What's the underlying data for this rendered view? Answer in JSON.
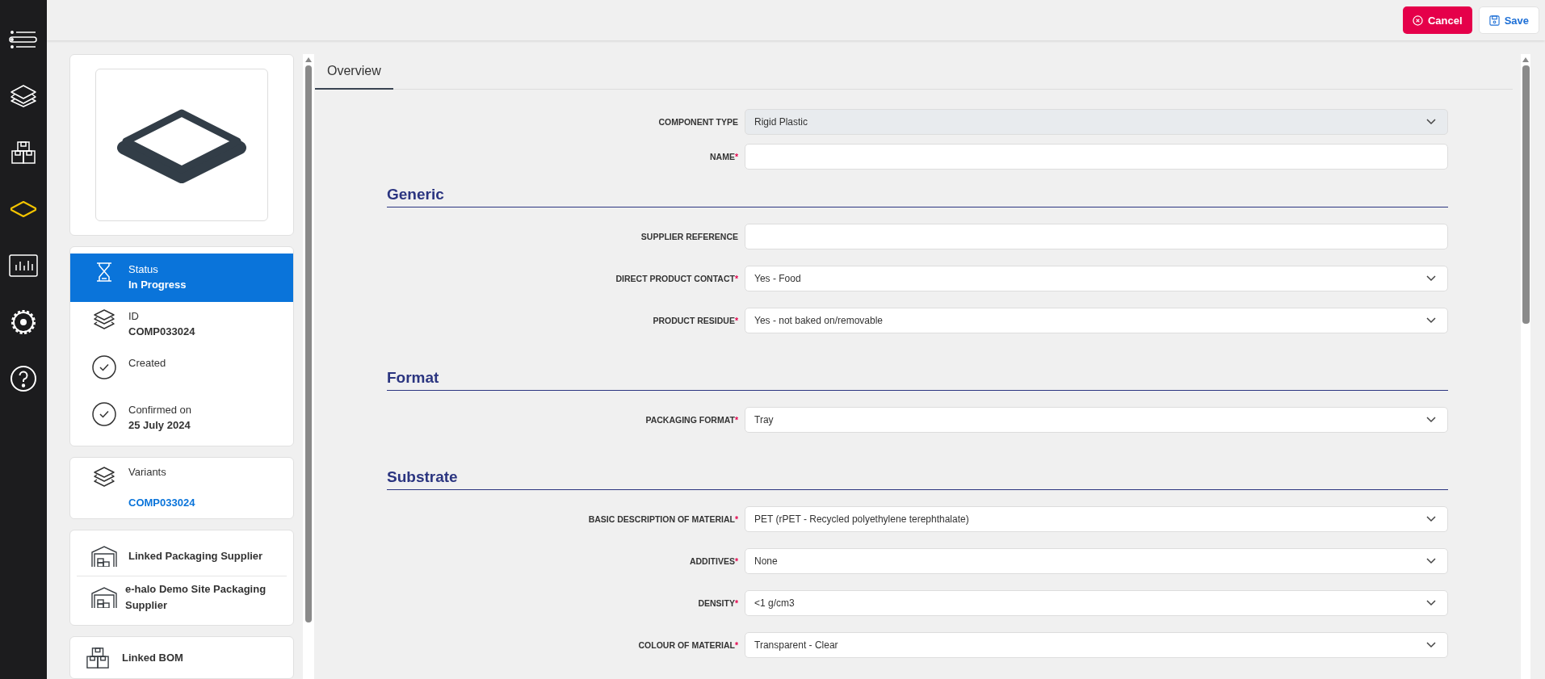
{
  "nav": [
    {
      "selected": false
    },
    {
      "selected": false
    },
    {
      "selected": false
    },
    {
      "selected": true
    },
    {
      "selected": false
    },
    {
      "selected": false
    },
    {
      "selected": false
    }
  ],
  "actions": {
    "cancel": "Cancel",
    "save": "Save"
  },
  "status_items": [
    {
      "kind": "hourglass",
      "label": "Status",
      "value": "In Progress",
      "selected": true
    },
    {
      "kind": "layers",
      "label": "ID",
      "value": "COMP033024",
      "selected": false
    },
    {
      "kind": "check",
      "label": "Created",
      "selected": false
    },
    {
      "kind": "check",
      "label": "Confirmed on",
      "value": "25 July 2024",
      "selected": false
    }
  ],
  "variants": {
    "label": "Variants",
    "link": "COMP033024"
  },
  "suppliers": [
    "Linked Packaging Supplier",
    "e-halo Demo Site Packaging Supplier"
  ],
  "bom": "Linked BOM",
  "tabs": [
    {
      "label": "Overview",
      "selected": true
    }
  ],
  "sections": [
    {
      "fields": [
        {
          "label": "COMPONENT TYPE",
          "kind": "select",
          "value": "Rigid Plastic",
          "disabled": true
        },
        {
          "label": "NAME",
          "required_mark": "*",
          "kind": "text",
          "disabled": false
        }
      ]
    },
    {
      "heading": "Generic",
      "fields": [
        {
          "label": "SUPPLIER REFERENCE",
          "kind": "text",
          "disabled": false
        },
        {
          "label": "DIRECT PRODUCT CONTACT",
          "required_mark": "*",
          "kind": "select",
          "value": "Yes - Food",
          "disabled": false
        },
        {
          "label": "PRODUCT RESIDUE",
          "required_mark": "*",
          "kind": "select",
          "value": "Yes - not baked on/removable",
          "disabled": false
        }
      ]
    },
    {
      "heading": "Format",
      "fields": [
        {
          "label": "PACKAGING FORMAT",
          "required_mark": "*",
          "kind": "select",
          "value": "Tray",
          "disabled": false
        }
      ]
    },
    {
      "heading": "Substrate",
      "fields": [
        {
          "label": "BASIC DESCRIPTION OF MATERIAL",
          "required_mark": "*",
          "kind": "select",
          "value": "PET (rPET - Recycled polyethylene terephthalate)",
          "disabled": false
        },
        {
          "label": "ADDITIVES",
          "required_mark": "*",
          "kind": "select",
          "value": "None",
          "disabled": false
        },
        {
          "label": "DENSITY",
          "required_mark": "*",
          "kind": "select",
          "value": "<1 g/cm3",
          "disabled": false
        },
        {
          "label": "COLOUR OF MATERIAL",
          "required_mark": "*",
          "kind": "select",
          "value": "Transparent - Clear",
          "disabled": false
        }
      ]
    }
  ]
}
